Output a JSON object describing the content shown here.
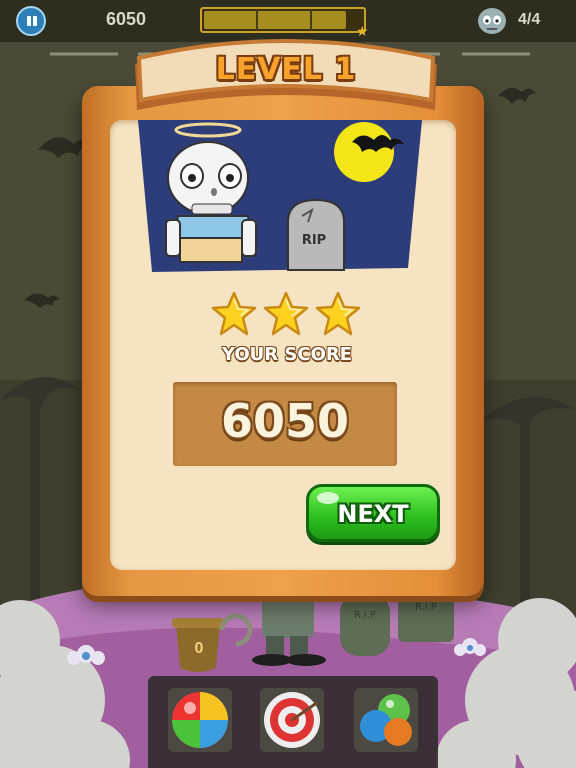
{
  "hud": {
    "score": "6050",
    "level_progress": 0.9,
    "zombie_count": "4/4",
    "icons": {
      "pause": "pause-icon",
      "zombie": "zombie-head-icon",
      "star": "star-icon"
    }
  },
  "dialog": {
    "title": "LEVEL 1",
    "picture": {
      "tombstone_text": "RIP"
    },
    "stars_earned": 3,
    "stars_total": 3,
    "score_label": "YOUR SCORE",
    "score_value": "6050",
    "next_label": "NEXT"
  },
  "background": {
    "tombstone_texts": [
      "R.I.P",
      "R.I.P"
    ],
    "pot_count": "0"
  },
  "boosters": [
    {
      "name": "rainbow-ball"
    },
    {
      "name": "target"
    },
    {
      "name": "color-bubbles"
    }
  ],
  "colors": {
    "panel_wood": "#eea04a",
    "panel_cream": "#f6e3c2",
    "title_orange": "#f7a22b",
    "next_green": "#2fc11f",
    "score_box": "#c48a45",
    "sky_night": "#2d3d7a",
    "moon": "#f2e619"
  }
}
